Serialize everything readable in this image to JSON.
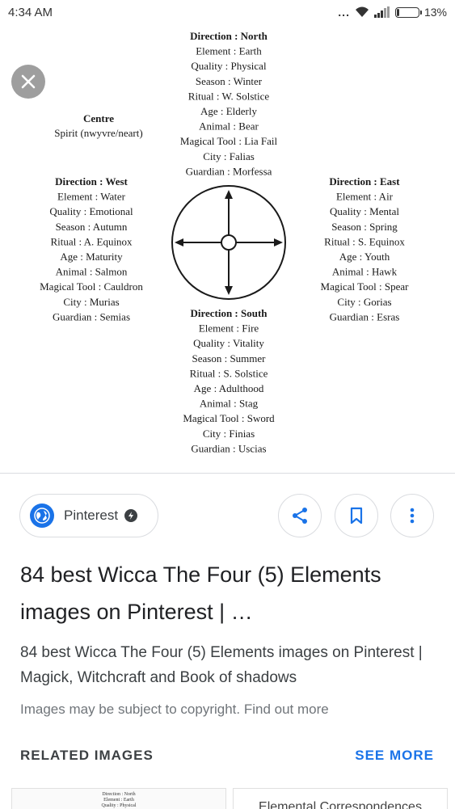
{
  "status_bar": {
    "time": "4:34 AM",
    "dots": "...",
    "battery": "13%",
    "battery_level": 0.13
  },
  "image": {
    "close_label": "close",
    "north": [
      "Direction : North",
      "Element : Earth",
      "Quality : Physical",
      "Season : Winter",
      "Ritual : W. Solstice",
      "Age : Elderly",
      "Animal : Bear",
      "Magical Tool : Lia Fail",
      "City : Falias",
      "Guardian : Morfessa"
    ],
    "centre": [
      "Centre",
      "Spirit (nwyvre/neart)"
    ],
    "west": [
      "Direction : West",
      "Element : Water",
      "Quality : Emotional",
      "Season : Autumn",
      "Ritual : A. Equinox",
      "Age : Maturity",
      "Animal : Salmon",
      "Magical Tool : Cauldron",
      "City : Murias",
      "Guardian : Semias"
    ],
    "east": [
      "Direction : East",
      "Element : Air",
      "Quality : Mental",
      "Season : Spring",
      "Ritual : S. Equinox",
      "Age : Youth",
      "Animal : Hawk",
      "Magical Tool : Spear",
      "City : Gorias",
      "Guardian : Esras"
    ],
    "south": [
      "Direction : South",
      "Element : Fire",
      "Quality : Vitality",
      "Season : Summer",
      "Ritual : S. Solstice",
      "Age : Adulthood",
      "Animal : Stag",
      "Magical Tool : Sword",
      "City : Finias",
      "Guardian : Uscias"
    ]
  },
  "source": {
    "name": "Pinterest",
    "icon": "globe-icon",
    "amp_icon": "amp-lightning-icon"
  },
  "actions": {
    "share_icon": "share-icon",
    "bookmark_icon": "bookmark-icon",
    "more_icon": "more-vert-icon"
  },
  "result": {
    "title": "84 best Wicca The Four (5) Elements images on Pinterest | …",
    "description": "84 best Wicca The Four (5) Elements images on Pinterest | Magick, Witchcraft and Book of shadows",
    "copyright_text": "Images may be subject to copyright. ",
    "copyright_link": "Find out more"
  },
  "related": {
    "header": "RELATED IMAGES",
    "see_more": "SEE MORE",
    "thumb1_lines": [
      "Direction : North",
      "Element : Earth",
      "Quality : Physical"
    ],
    "thumb2_text": "Elemental Correspondences"
  },
  "colors": {
    "accent": "#1a73e8",
    "close_bg": "#9e9e9e",
    "divider": "#dadce0",
    "text_secondary": "#70757a"
  }
}
